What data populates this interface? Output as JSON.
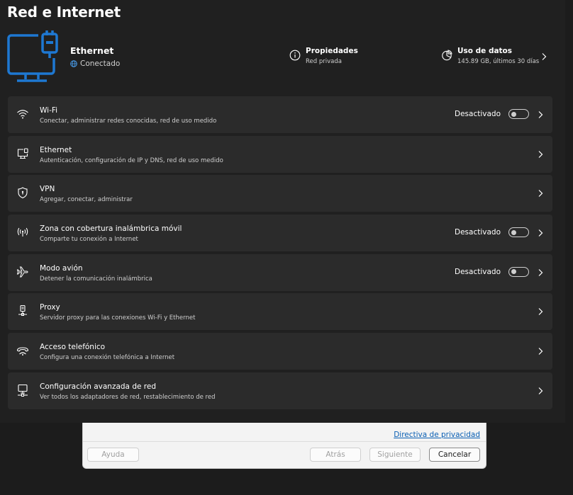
{
  "page": {
    "title": "Red e Internet"
  },
  "connection": {
    "name": "Ethernet",
    "status": "Conectado",
    "properties": {
      "label": "Propiedades",
      "value": "Red privada",
      "icon": "info-icon"
    },
    "data_usage": {
      "label": "Uso de datos",
      "value": "145.89 GB, últimos 30 días",
      "icon": "pie-chart-icon"
    }
  },
  "rows": [
    {
      "title": "Wi-Fi",
      "subtitle": "Conectar, administrar redes conocidas, red de uso medido",
      "state": "Desactivado",
      "icon": "wifi-icon"
    },
    {
      "title": "Ethernet",
      "subtitle": "Autenticación, configuración de IP y DNS, red de uso medido",
      "icon": "ethernet-icon"
    },
    {
      "title": "VPN",
      "subtitle": "Agregar, conectar, administrar",
      "icon": "shield-icon"
    },
    {
      "title": "Zona con cobertura inalámbrica móvil",
      "subtitle": "Comparte tu conexión a Internet",
      "state": "Desactivado",
      "icon": "hotspot-icon"
    },
    {
      "title": "Modo avión",
      "subtitle": "Detener la comunicación inalámbrica",
      "state": "Desactivado",
      "icon": "airplane-icon"
    },
    {
      "title": "Proxy",
      "subtitle": "Servidor proxy para las conexiones Wi-Fi y Ethernet",
      "icon": "proxy-icon"
    },
    {
      "title": "Acceso telefónico",
      "subtitle": "Configura una conexión telefónica a Internet",
      "icon": "dial-up-icon"
    },
    {
      "title": "Configuración avanzada de red",
      "subtitle": "Ver todos los adaptadores de red, restablecimiento de red",
      "icon": "network-adapter-icon"
    }
  ],
  "dialog": {
    "privacy_link": "Directiva de privacidad",
    "help": "Ayuda",
    "back": "Atrás",
    "next": "Siguiente",
    "cancel": "Cancelar"
  },
  "colors": {
    "accent": "#1e78d2",
    "background": "#202020",
    "card": "#2b2b2b"
  }
}
